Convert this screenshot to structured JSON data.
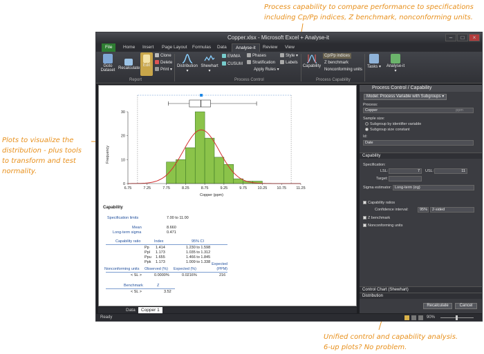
{
  "callouts": {
    "top": [
      "Process capability to compare performance to specifications",
      "including Cp/Pp indices, Z benchmark, nonconforming units."
    ],
    "left": [
      "Plots to visualize the",
      "distribution - plus tools",
      "to transform and test",
      "normality."
    ],
    "bottom": [
      "Unified control and capability analysis.",
      "6-up plots? No problem."
    ]
  },
  "window": {
    "title": "Copper.xlsx - Microsoft Excel + Analyse-it"
  },
  "tabs": [
    "File",
    "Home",
    "Insert",
    "Page Layout",
    "Formulas",
    "Data",
    "Analyse-it",
    "Review",
    "View"
  ],
  "ribbon": {
    "goto_dataset": "Goto Dataset",
    "recalculate": "Recalculate",
    "edit": "Edit",
    "clone": "Clone",
    "delete": "Delete",
    "print": "Print",
    "report_group": "Report",
    "distribution": "Distribution",
    "shewhart": "Shewhart",
    "ewma": "EWMA",
    "cusum": "CUSUM",
    "phases": "Phases",
    "stratification": "Stratification",
    "apply_rules": "Apply Rules",
    "style": "Style",
    "labels": "Labels",
    "process_control_group": "Process Control",
    "capability": "Capability",
    "cp_pp": "Cp/Pp indices",
    "z_benchmark": "Z benchmark",
    "nonconforming": "Nonconforming units",
    "process_capability_group": "Process Capability",
    "tasks": "Tasks",
    "analyse_it": "Analyse-it"
  },
  "chart_data": {
    "type": "bar",
    "x": [
      7.75,
      8.0,
      8.25,
      8.5,
      8.75,
      9.0,
      9.25,
      9.5,
      9.75,
      10.0
    ],
    "values": [
      9,
      10,
      15,
      30,
      19,
      11,
      8,
      2,
      1,
      1
    ],
    "bin_width": 0.25,
    "xlabel": "Copper (ppm)",
    "ylabel": "Frequency",
    "xticks": [
      "6.75",
      "7.25",
      "7.75",
      "8.25",
      "8.75",
      "9.25",
      "9.75",
      "10.25",
      "10.75",
      "11.25"
    ],
    "yticks": [
      "0",
      "10",
      "20",
      "30"
    ],
    "xlim": [
      6.75,
      11.25
    ],
    "ylim": [
      0,
      30
    ],
    "normal_curve": {
      "mean": 8.66,
      "sd": 0.471
    },
    "boxplot": {
      "min": 7.8,
      "q1": 8.35,
      "median": 8.65,
      "q3": 8.9,
      "max": 10.1,
      "mean": 8.66
    },
    "colors": {
      "bar": "#8bc34a",
      "bar_edge": "#2e6b1e",
      "curve": "#d32f2f",
      "box_mean": "#1e88e5"
    }
  },
  "report": {
    "title": "Capability",
    "spec_limits_label": "Specification limits",
    "spec_limits_value": "7.00 to 11.00",
    "mean_label": "Mean",
    "mean_value": "8.660",
    "sigma_label": "Long-term sigma",
    "sigma_value": "0.471",
    "ratio_headers": [
      "Capability ratio",
      "Index",
      "95% CI"
    ],
    "ratio_rows": [
      {
        "name": "Pp",
        "index": "1.414",
        "ci": "1.230 to 1.598"
      },
      {
        "name": "Ppl",
        "index": "1.173",
        "ci": "1.035 to 1.312"
      },
      {
        "name": "Ppu",
        "index": "1.655",
        "ci": "1.466 to 1.845"
      },
      {
        "name": "Ppk",
        "index": "1.173",
        "ci": "1.009 to 1.338"
      }
    ],
    "nc_headers": [
      "Nonconforming units",
      "Observed (%)",
      "Expected (%)",
      "Expected (PPM)"
    ],
    "nc_row": {
      "name": "< SL >",
      "observed": "0.0000%",
      "expected": "0.0216%",
      "ppm": "216"
    },
    "bench_headers": [
      "Benchmark",
      "Z"
    ],
    "bench_row": {
      "name": "< SL >",
      "z": "3.52"
    }
  },
  "sheet_tabs": [
    "Data",
    "Copper 1"
  ],
  "status": {
    "ready": "Ready",
    "zoom": "90%"
  },
  "panel": {
    "title": "Process Control / Capability",
    "model": "Model: Process Variable with Subgroups",
    "process_label": "Process:",
    "process_value": "Copper",
    "process_hint": "ppm",
    "sample_size_label": "Sample size:",
    "radio1": "Subgroup by identifier variable",
    "radio2": "Subgroup size constant",
    "id_label": "Id:",
    "id_value": "Date",
    "capability_section": "Capability",
    "specification_label": "Specification:",
    "lsl_label": "LSL:",
    "lsl_value": "7",
    "usl_label": "USL:",
    "usl_value": "11",
    "target_label": "Target:",
    "sigma_est_label": "Sigma estimator:",
    "sigma_est_value": "Long-term (σg)",
    "cap_ratios": "Capability ratios",
    "conf_label": "Confidence interval:",
    "conf_value": "95%",
    "sided_value": "2-sided",
    "z_bench": "Z benchmark",
    "nonconf": "Nonconforming units",
    "control_chart_section": "Control Chart (Shewhart)",
    "distribution_section": "Distribution",
    "recalculate_btn": "Recalculate",
    "cancel_btn": "Cancel"
  }
}
